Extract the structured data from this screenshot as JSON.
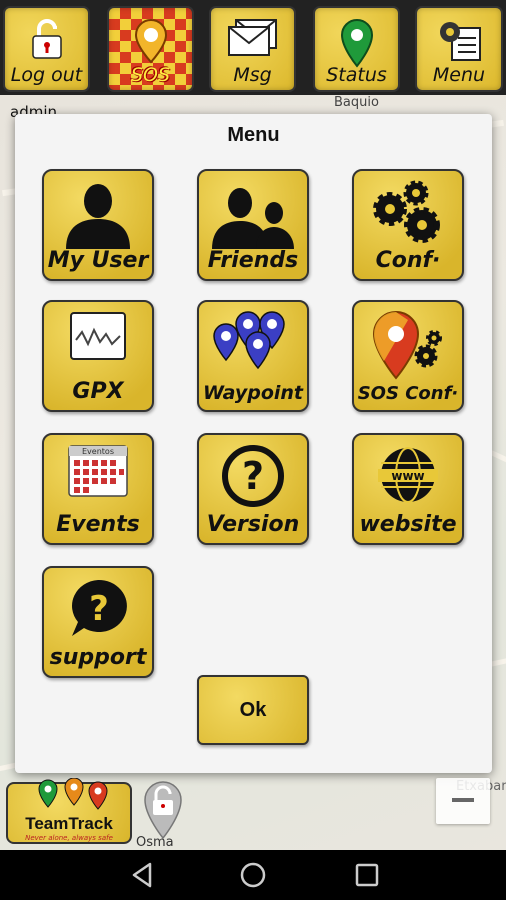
{
  "toolbar": {
    "buttons": [
      {
        "label": "Log out",
        "icon": "unlock-icon"
      },
      {
        "label": "SOS",
        "icon": "sos-pin-icon"
      },
      {
        "label": "Msg",
        "icon": "envelope-icon"
      },
      {
        "label": "Status",
        "icon": "map-pin-icon"
      },
      {
        "label": "Menu",
        "icon": "gear-list-icon"
      }
    ]
  },
  "map": {
    "labels": {
      "admin": "admin",
      "baquio": "Baquio",
      "etxa": "Etxabar",
      "osma": "Osma"
    }
  },
  "dialog": {
    "title": "Menu",
    "tiles": [
      {
        "label": "My User",
        "icon": "user-icon"
      },
      {
        "label": "Friends",
        "icon": "friends-icon"
      },
      {
        "label": "Conf·",
        "icon": "gears-icon"
      },
      {
        "label": "GPX",
        "icon": "gpx-track-icon"
      },
      {
        "label": "Waypoint",
        "icon": "waypoints-icon"
      },
      {
        "label": "SOS Conf·",
        "icon": "sos-config-icon"
      },
      {
        "label": "Events",
        "icon": "calendar-icon"
      },
      {
        "label": "Version",
        "icon": "question-circle-icon"
      },
      {
        "label": "website",
        "icon": "globe-www-icon"
      },
      {
        "label": "support",
        "icon": "question-bubble-icon"
      }
    ],
    "ok_label": "Ok",
    "calendar_header": "Eventos"
  },
  "logo": {
    "title": "TeamTrack",
    "slogan": "Never alone, always safe"
  },
  "colors": {
    "tile_yellow": "#e8c838",
    "border": "#333333",
    "sos_red": "#d83b1f"
  }
}
